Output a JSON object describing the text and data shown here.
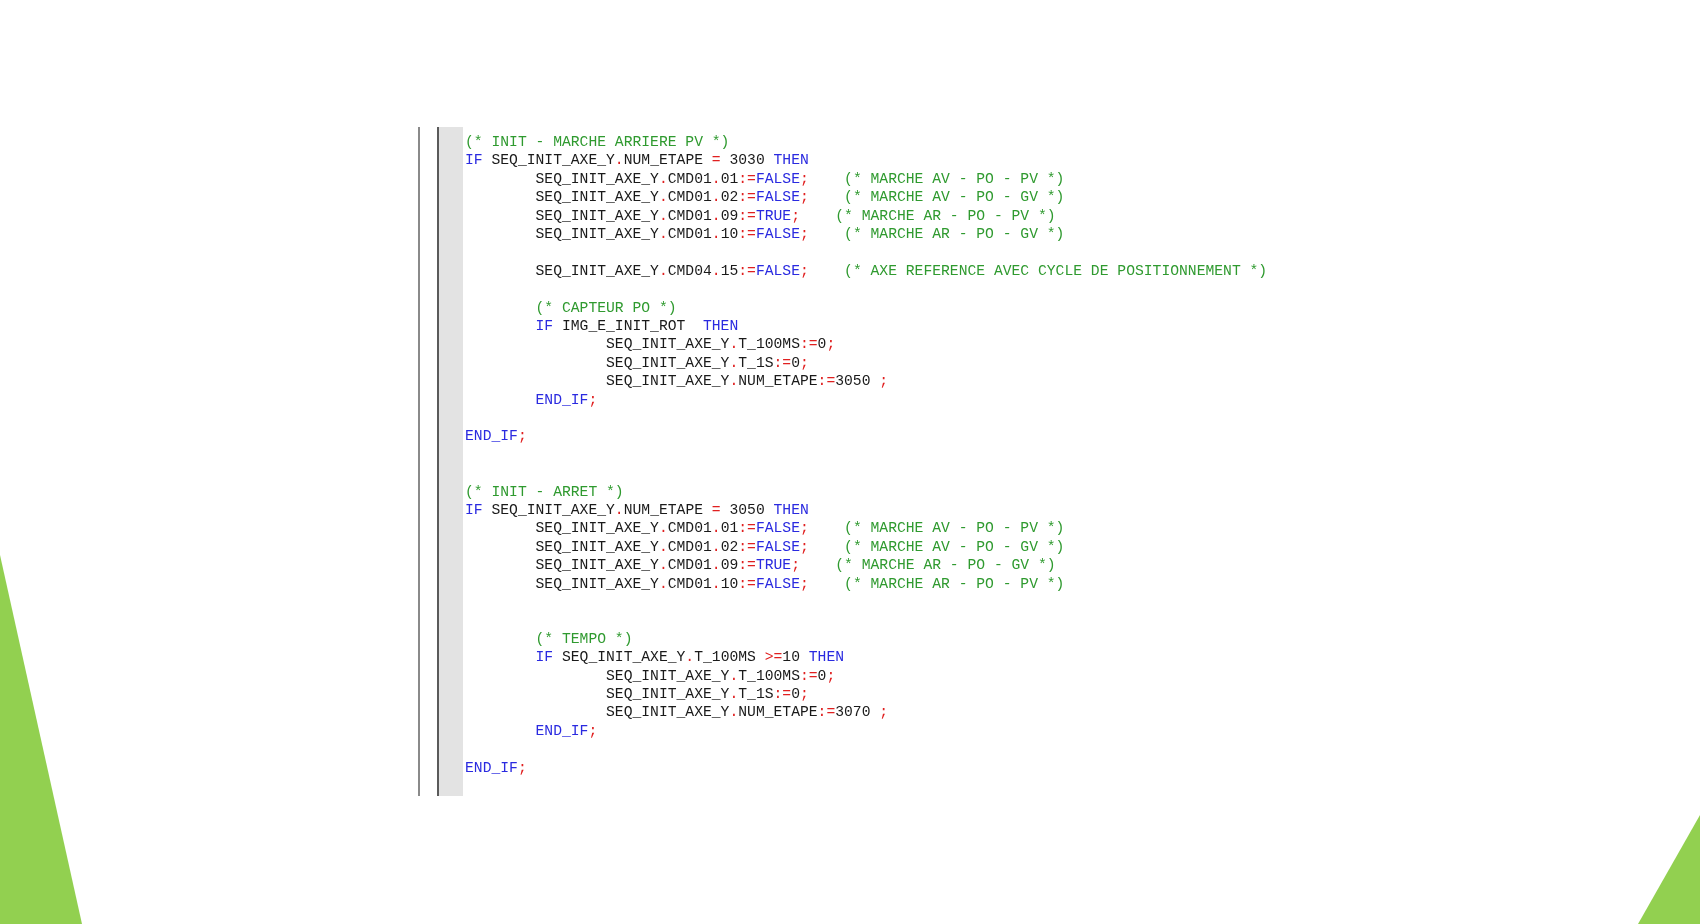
{
  "code": [
    {
      "kind": "code",
      "tokens": [
        {
          "kind": "comment",
          "text": "(* INIT - MARCHE ARRIERE PV *)"
        }
      ]
    },
    {
      "kind": "code",
      "tokens": [
        {
          "kind": "keyword",
          "text": "IF"
        },
        {
          "kind": "ident",
          "text": " SEQ_INIT_AXE_Y"
        },
        {
          "kind": "op",
          "text": "."
        },
        {
          "kind": "ident",
          "text": "NUM_ETAPE "
        },
        {
          "kind": "op",
          "text": "="
        },
        {
          "kind": "number",
          "text": " 3030 "
        },
        {
          "kind": "keyword",
          "text": "THEN"
        }
      ],
      "children": [
        {
          "kind": "code",
          "tokens": [
            {
              "kind": "ident",
              "text": "SEQ_INIT_AXE_Y"
            },
            {
              "kind": "op",
              "text": "."
            },
            {
              "kind": "ident",
              "text": "CMD01"
            },
            {
              "kind": "op",
              "text": "."
            },
            {
              "kind": "number",
              "text": "01"
            },
            {
              "kind": "op",
              "text": ":="
            },
            {
              "kind": "keyword",
              "text": "FALSE"
            },
            {
              "kind": "op",
              "text": ";"
            },
            {
              "kind": "comment",
              "text": "    (* MARCHE AV - PO - PV *)"
            }
          ]
        },
        {
          "kind": "code",
          "tokens": [
            {
              "kind": "ident",
              "text": "SEQ_INIT_AXE_Y"
            },
            {
              "kind": "op",
              "text": "."
            },
            {
              "kind": "ident",
              "text": "CMD01"
            },
            {
              "kind": "op",
              "text": "."
            },
            {
              "kind": "number",
              "text": "02"
            },
            {
              "kind": "op",
              "text": ":="
            },
            {
              "kind": "keyword",
              "text": "FALSE"
            },
            {
              "kind": "op",
              "text": ";"
            },
            {
              "kind": "comment",
              "text": "    (* MARCHE AV - PO - GV *)"
            }
          ]
        },
        {
          "kind": "code",
          "tokens": [
            {
              "kind": "ident",
              "text": "SEQ_INIT_AXE_Y"
            },
            {
              "kind": "op",
              "text": "."
            },
            {
              "kind": "ident",
              "text": "CMD01"
            },
            {
              "kind": "op",
              "text": "."
            },
            {
              "kind": "number",
              "text": "09"
            },
            {
              "kind": "op",
              "text": ":="
            },
            {
              "kind": "keyword",
              "text": "TRUE"
            },
            {
              "kind": "op",
              "text": ";"
            },
            {
              "kind": "comment",
              "text": "    (* MARCHE AR - PO - PV *)"
            }
          ]
        },
        {
          "kind": "code",
          "tokens": [
            {
              "kind": "ident",
              "text": "SEQ_INIT_AXE_Y"
            },
            {
              "kind": "op",
              "text": "."
            },
            {
              "kind": "ident",
              "text": "CMD01"
            },
            {
              "kind": "op",
              "text": "."
            },
            {
              "kind": "number",
              "text": "10"
            },
            {
              "kind": "op",
              "text": ":="
            },
            {
              "kind": "keyword",
              "text": "FALSE"
            },
            {
              "kind": "op",
              "text": ";"
            },
            {
              "kind": "comment",
              "text": "    (* MARCHE AR - PO - GV *)"
            }
          ]
        },
        {
          "kind": "blank"
        },
        {
          "kind": "code",
          "tokens": [
            {
              "kind": "ident",
              "text": "SEQ_INIT_AXE_Y"
            },
            {
              "kind": "op",
              "text": "."
            },
            {
              "kind": "ident",
              "text": "CMD04"
            },
            {
              "kind": "op",
              "text": "."
            },
            {
              "kind": "number",
              "text": "15"
            },
            {
              "kind": "op",
              "text": ":="
            },
            {
              "kind": "keyword",
              "text": "FALSE"
            },
            {
              "kind": "op",
              "text": ";"
            },
            {
              "kind": "comment",
              "text": "    (* AXE REFERENCE AVEC CYCLE DE POSITIONNEMENT *)"
            }
          ]
        },
        {
          "kind": "blank"
        },
        {
          "kind": "code",
          "tokens": [
            {
              "kind": "comment",
              "text": "(* CAPTEUR PO *)"
            }
          ]
        },
        {
          "kind": "code",
          "tokens": [
            {
              "kind": "keyword",
              "text": "IF"
            },
            {
              "kind": "ident",
              "text": " IMG_E_INIT_ROT  "
            },
            {
              "kind": "keyword",
              "text": "THEN"
            }
          ],
          "children": [
            {
              "kind": "code",
              "tokens": [
                {
                  "kind": "ident",
                  "text": "SEQ_INIT_AXE_Y"
                },
                {
                  "kind": "op",
                  "text": "."
                },
                {
                  "kind": "ident",
                  "text": "T_100MS"
                },
                {
                  "kind": "op",
                  "text": ":="
                },
                {
                  "kind": "number",
                  "text": "0"
                },
                {
                  "kind": "op",
                  "text": ";"
                }
              ]
            },
            {
              "kind": "code",
              "tokens": [
                {
                  "kind": "ident",
                  "text": "SEQ_INIT_AXE_Y"
                },
                {
                  "kind": "op",
                  "text": "."
                },
                {
                  "kind": "ident",
                  "text": "T_1S"
                },
                {
                  "kind": "op",
                  "text": ":="
                },
                {
                  "kind": "number",
                  "text": "0"
                },
                {
                  "kind": "op",
                  "text": ";"
                }
              ]
            },
            {
              "kind": "code",
              "tokens": [
                {
                  "kind": "ident",
                  "text": "SEQ_INIT_AXE_Y"
                },
                {
                  "kind": "op",
                  "text": "."
                },
                {
                  "kind": "ident",
                  "text": "NUM_ETAPE"
                },
                {
                  "kind": "op",
                  "text": ":="
                },
                {
                  "kind": "number",
                  "text": "3050"
                },
                {
                  "kind": "op",
                  "text": " ;"
                }
              ]
            }
          ]
        },
        {
          "kind": "code",
          "tokens": [
            {
              "kind": "keyword",
              "text": "END_IF"
            },
            {
              "kind": "op",
              "text": ";"
            }
          ]
        },
        {
          "kind": "blank"
        }
      ]
    },
    {
      "kind": "code",
      "tokens": [
        {
          "kind": "keyword",
          "text": "END_IF"
        },
        {
          "kind": "op",
          "text": ";"
        }
      ]
    },
    {
      "kind": "blank"
    },
    {
      "kind": "blank"
    },
    {
      "kind": "code",
      "tokens": [
        {
          "kind": "comment",
          "text": "(* INIT - ARRET *)"
        }
      ]
    },
    {
      "kind": "code",
      "tokens": [
        {
          "kind": "keyword",
          "text": "IF"
        },
        {
          "kind": "ident",
          "text": " SEQ_INIT_AXE_Y"
        },
        {
          "kind": "op",
          "text": "."
        },
        {
          "kind": "ident",
          "text": "NUM_ETAPE "
        },
        {
          "kind": "op",
          "text": "="
        },
        {
          "kind": "number",
          "text": " 3050 "
        },
        {
          "kind": "keyword",
          "text": "THEN"
        }
      ],
      "children": [
        {
          "kind": "code",
          "tokens": [
            {
              "kind": "ident",
              "text": "SEQ_INIT_AXE_Y"
            },
            {
              "kind": "op",
              "text": "."
            },
            {
              "kind": "ident",
              "text": "CMD01"
            },
            {
              "kind": "op",
              "text": "."
            },
            {
              "kind": "number",
              "text": "01"
            },
            {
              "kind": "op",
              "text": ":="
            },
            {
              "kind": "keyword",
              "text": "FALSE"
            },
            {
              "kind": "op",
              "text": ";"
            },
            {
              "kind": "comment",
              "text": "    (* MARCHE AV - PO - PV *)"
            }
          ]
        },
        {
          "kind": "code",
          "tokens": [
            {
              "kind": "ident",
              "text": "SEQ_INIT_AXE_Y"
            },
            {
              "kind": "op",
              "text": "."
            },
            {
              "kind": "ident",
              "text": "CMD01"
            },
            {
              "kind": "op",
              "text": "."
            },
            {
              "kind": "number",
              "text": "02"
            },
            {
              "kind": "op",
              "text": ":="
            },
            {
              "kind": "keyword",
              "text": "FALSE"
            },
            {
              "kind": "op",
              "text": ";"
            },
            {
              "kind": "comment",
              "text": "    (* MARCHE AV - PO - GV *)"
            }
          ]
        },
        {
          "kind": "code",
          "tokens": [
            {
              "kind": "ident",
              "text": "SEQ_INIT_AXE_Y"
            },
            {
              "kind": "op",
              "text": "."
            },
            {
              "kind": "ident",
              "text": "CMD01"
            },
            {
              "kind": "op",
              "text": "."
            },
            {
              "kind": "number",
              "text": "09"
            },
            {
              "kind": "op",
              "text": ":="
            },
            {
              "kind": "keyword",
              "text": "TRUE"
            },
            {
              "kind": "op",
              "text": ";"
            },
            {
              "kind": "comment",
              "text": "    (* MARCHE AR - PO - GV *)"
            }
          ]
        },
        {
          "kind": "code",
          "tokens": [
            {
              "kind": "ident",
              "text": "SEQ_INIT_AXE_Y"
            },
            {
              "kind": "op",
              "text": "."
            },
            {
              "kind": "ident",
              "text": "CMD01"
            },
            {
              "kind": "op",
              "text": "."
            },
            {
              "kind": "number",
              "text": "10"
            },
            {
              "kind": "op",
              "text": ":="
            },
            {
              "kind": "keyword",
              "text": "FALSE"
            },
            {
              "kind": "op",
              "text": ";"
            },
            {
              "kind": "comment",
              "text": "    (* MARCHE AR - PO - PV *)"
            }
          ]
        },
        {
          "kind": "blank"
        },
        {
          "kind": "blank"
        },
        {
          "kind": "code",
          "tokens": [
            {
              "kind": "comment",
              "text": "(* TEMPO *)"
            }
          ]
        },
        {
          "kind": "code",
          "tokens": [
            {
              "kind": "keyword",
              "text": "IF"
            },
            {
              "kind": "ident",
              "text": " SEQ_INIT_AXE_Y"
            },
            {
              "kind": "op",
              "text": "."
            },
            {
              "kind": "ident",
              "text": "T_100MS "
            },
            {
              "kind": "op",
              "text": ">="
            },
            {
              "kind": "number",
              "text": "10 "
            },
            {
              "kind": "keyword",
              "text": "THEN"
            }
          ],
          "children": [
            {
              "kind": "code",
              "tokens": [
                {
                  "kind": "ident",
                  "text": "SEQ_INIT_AXE_Y"
                },
                {
                  "kind": "op",
                  "text": "."
                },
                {
                  "kind": "ident",
                  "text": "T_100MS"
                },
                {
                  "kind": "op",
                  "text": ":="
                },
                {
                  "kind": "number",
                  "text": "0"
                },
                {
                  "kind": "op",
                  "text": ";"
                }
              ]
            },
            {
              "kind": "code",
              "tokens": [
                {
                  "kind": "ident",
                  "text": "SEQ_INIT_AXE_Y"
                },
                {
                  "kind": "op",
                  "text": "."
                },
                {
                  "kind": "ident",
                  "text": "T_1S"
                },
                {
                  "kind": "op",
                  "text": ":="
                },
                {
                  "kind": "number",
                  "text": "0"
                },
                {
                  "kind": "op",
                  "text": ";"
                }
              ]
            },
            {
              "kind": "code",
              "tokens": [
                {
                  "kind": "ident",
                  "text": "SEQ_INIT_AXE_Y"
                },
                {
                  "kind": "op",
                  "text": "."
                },
                {
                  "kind": "ident",
                  "text": "NUM_ETAPE"
                },
                {
                  "kind": "op",
                  "text": ":="
                },
                {
                  "kind": "number",
                  "text": "3070"
                },
                {
                  "kind": "op",
                  "text": " ;"
                }
              ]
            }
          ]
        },
        {
          "kind": "code",
          "tokens": [
            {
              "kind": "keyword",
              "text": "END_IF"
            },
            {
              "kind": "op",
              "text": ";"
            }
          ]
        },
        {
          "kind": "blank"
        }
      ]
    },
    {
      "kind": "code",
      "tokens": [
        {
          "kind": "keyword",
          "text": "END_IF"
        },
        {
          "kind": "op",
          "text": ";"
        }
      ]
    }
  ]
}
